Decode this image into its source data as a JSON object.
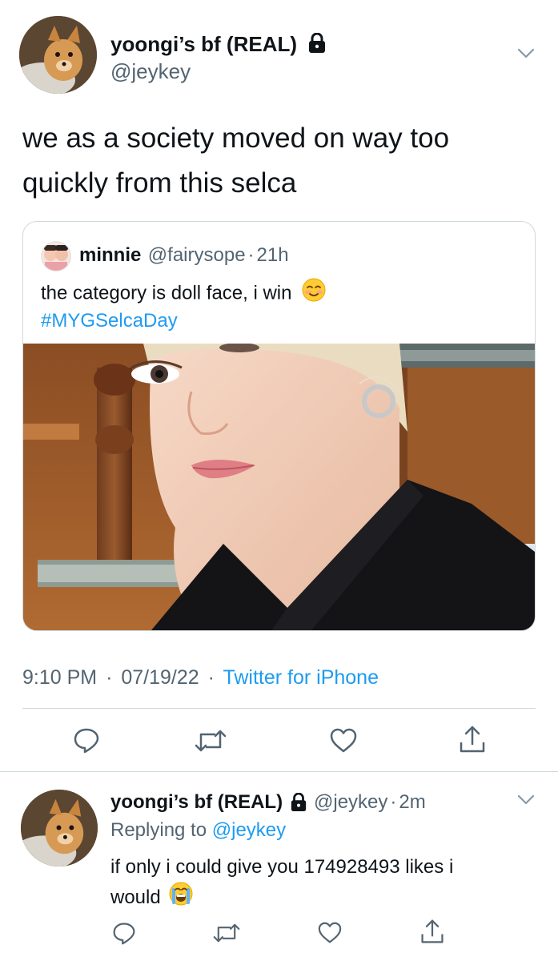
{
  "tweet": {
    "author_name": "yoongi’s bf (REAL)",
    "author_handle": "@jeykey",
    "text": "we as a society moved on way too quickly from this selca",
    "timestamp": "9:10 PM",
    "date": "07/19/22",
    "separator": "·",
    "source": "Twitter for iPhone"
  },
  "quoted": {
    "name": "minnie",
    "handle": "@fairysope",
    "separator": "·",
    "age": "21h",
    "text": "the category is doll face, i win",
    "hashtag": "#MYGSelcaDay"
  },
  "reply": {
    "author_name": "yoongi’s bf (REAL)",
    "author_handle": "@jeykey",
    "separator": "·",
    "age": "2m",
    "replying_prefix": "Replying to",
    "replying_to": "@jeykey",
    "text_line1": "if only i could give you 174928493 likes i",
    "text_line2": "would"
  },
  "icons": {
    "lock": "lock-icon",
    "chevron": "chevron-down-icon",
    "reply": "reply-icon",
    "retweet": "retweet-icon",
    "like": "heart-icon",
    "share": "share-icon"
  },
  "colors": {
    "accent": "#1d9bf0",
    "secondary_text": "#536471",
    "border": "#cfd9de"
  }
}
